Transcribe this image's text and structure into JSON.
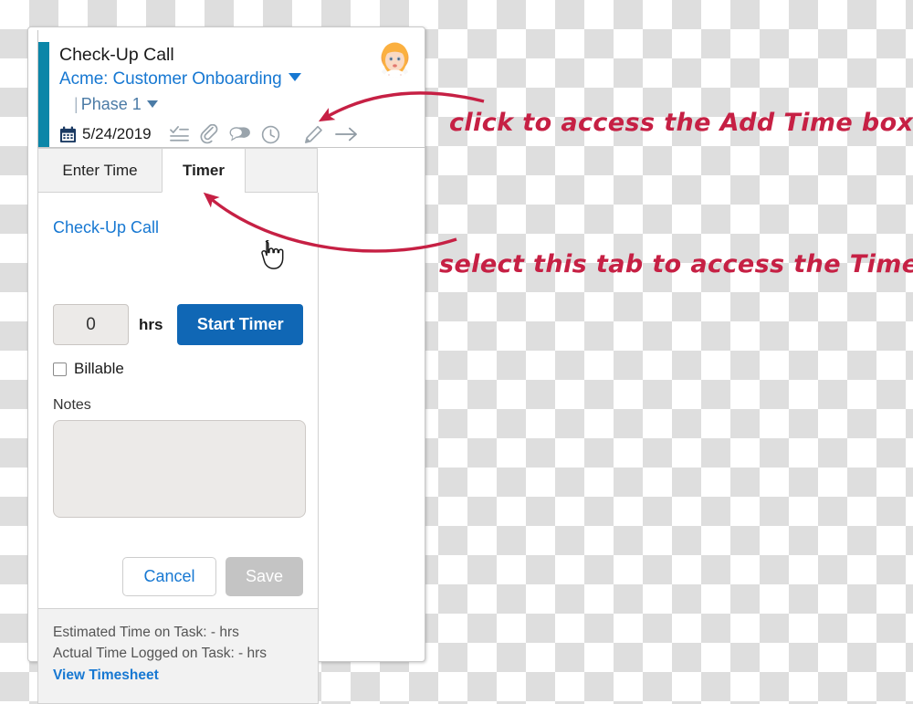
{
  "card": {
    "header": {
      "task_title": "Check-Up Call",
      "project_link": "Acme: Customer Onboarding",
      "phase_divider": "|",
      "phase_link": "Phase 1",
      "date": "5/24/2019",
      "icons": [
        "checklist-icon",
        "paperclip-icon",
        "chat-bubble-icon",
        "clock-icon",
        "pencil-icon",
        "arrow-right-icon"
      ],
      "avatar_alt": "user-avatar",
      "accent_color": "#0b86a8"
    },
    "tabs": [
      {
        "label": "Enter Time",
        "active": false
      },
      {
        "label": "Timer",
        "active": true
      },
      {
        "label": "",
        "active": false
      }
    ],
    "body": {
      "task_link": "Check-Up Call",
      "hours_value": "0",
      "hours_placeholder": "0",
      "hours_unit": "hrs",
      "start_timer_label": "Start Timer",
      "start_timer_color": "#1067b5",
      "billable_label": "Billable",
      "billable_checked": false,
      "notes_label": "Notes",
      "notes_value": "",
      "notes_placeholder": "",
      "cancel_label": "Cancel",
      "save_label": "Save",
      "save_disabled": true
    },
    "footer": {
      "estimated_time": "Estimated Time on Task: - hrs",
      "actual_time": "Actual Time Logged on Task: - hrs",
      "view_timesheet_label": "View Timesheet"
    }
  },
  "annotations": {
    "color": "#c62044",
    "one": "click to access the Add Time box",
    "two": "select this tab to access the Timer"
  }
}
